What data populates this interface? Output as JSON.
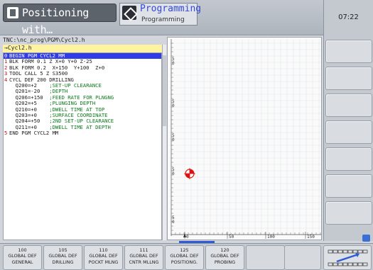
{
  "header": {
    "mode_tab_label": "Positioning with…",
    "prog_tab_title": "Programming",
    "prog_tab_subtitle": "Programming"
  },
  "clock": "07:22",
  "program": {
    "path": "TNC:\\nc_prog\\PGM\\Cycl2.h",
    "file_tab": "→Cycl2.h",
    "lines": [
      {
        "num": "0",
        "code": "BEGIN PGM CYCL2 MM",
        "comment": ""
      },
      {
        "num": "1",
        "code": "BLK FORM 0.1 Z X+0 Y+0 Z-25",
        "comment": ""
      },
      {
        "num": "2",
        "code": "BLK FORM 0.2  X+150  Y+100  Z+0",
        "comment": ""
      },
      {
        "num": "3",
        "code": "TOOL CALL 5 Z S3500",
        "comment": ""
      },
      {
        "num": "4",
        "code": "CYCL DEF 200 DRILLING",
        "comment": ""
      },
      {
        "num": "",
        "code": "  Q200=+2    ",
        "comment": ";SET-UP CLEARANCE"
      },
      {
        "num": "",
        "code": "  Q201=-20   ",
        "comment": ";DEPTH"
      },
      {
        "num": "",
        "code": "  Q206=+150  ",
        "comment": ";FEED RATE FOR PLNGNG"
      },
      {
        "num": "",
        "code": "  Q202=+5    ",
        "comment": ";PLUNGING DEPTH"
      },
      {
        "num": "",
        "code": "  Q210=+0    ",
        "comment": ";DWELL TIME AT TOP"
      },
      {
        "num": "",
        "code": "  Q203=+0    ",
        "comment": ";SURFACE COORDINATE"
      },
      {
        "num": "",
        "code": "  Q204=+50   ",
        "comment": ";2ND SET-UP CLEARANCE"
      },
      {
        "num": "",
        "code": "  Q211=+0    ",
        "comment": ";DWELL TIME AT DEPTH"
      },
      {
        "num": "5",
        "code": "END PGM CYCL2 MM",
        "comment": ""
      }
    ]
  },
  "graphic": {
    "y_ticks": [
      "5",
      "0",
      "5",
      "0",
      "5",
      "0",
      "5",
      "0",
      "5",
      "0"
    ],
    "x_ticks": [
      "0",
      "50",
      "100",
      "150"
    ]
  },
  "softkeys": [
    {
      "line1": "100",
      "line2": "GLOBAL DEF",
      "line3": "GENERAL"
    },
    {
      "line1": "105",
      "line2": "GLOBAL DEF",
      "line3": "DRILLING"
    },
    {
      "line1": "110",
      "line2": "GLOBAL DEF",
      "line3": "POCKT MLNG"
    },
    {
      "line1": "111",
      "line2": "GLOBAL DEF",
      "line3": "CNTR MLLNG"
    },
    {
      "line1": "125",
      "line2": "GLOBAL DEF",
      "line3": "POSITIONG."
    },
    {
      "line1": "120",
      "line2": "GLOBAL DEF",
      "line3": "PROBING"
    }
  ],
  "colors": {
    "selection": "#2f3ce8",
    "comment": "#0a7a1a",
    "line_number": "#c01010",
    "program_tab_title": "#3349d8"
  }
}
